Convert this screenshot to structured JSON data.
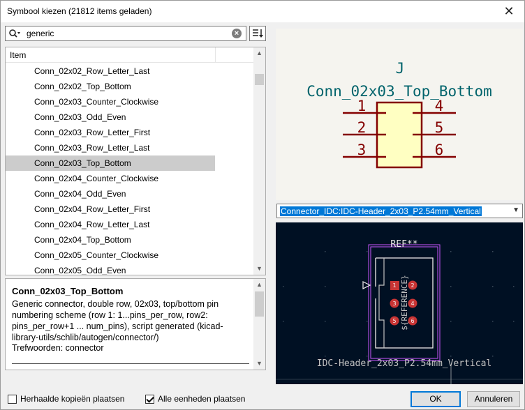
{
  "window": {
    "title": "Symbool kiezen (21812 items geladen)"
  },
  "search": {
    "value": "generic"
  },
  "tree": {
    "column_header": "Item",
    "items": [
      "Conn_02x02_Row_Letter_Last",
      "Conn_02x02_Top_Bottom",
      "Conn_02x03_Counter_Clockwise",
      "Conn_02x03_Odd_Even",
      "Conn_02x03_Row_Letter_First",
      "Conn_02x03_Row_Letter_Last",
      "Conn_02x03_Top_Bottom",
      "Conn_02x04_Counter_Clockwise",
      "Conn_02x04_Odd_Even",
      "Conn_02x04_Row_Letter_First",
      "Conn_02x04_Row_Letter_Last",
      "Conn_02x04_Top_Bottom",
      "Conn_02x05_Counter_Clockwise",
      "Conn_02x05_Odd_Even"
    ],
    "selected": "Conn_02x03_Top_Bottom"
  },
  "description": {
    "name": "Conn_02x03_Top_Bottom",
    "text": "Generic connector, double row, 02x03, top/bottom pin numbering scheme (row 1: 1...pins_per_row, row2: pins_per_row+1 ... num_pins), script generated (kicad-library-utils/schlib/autogen/connector/)",
    "keywords": "Trefwoorden: connector"
  },
  "symbol_preview": {
    "reference": "J",
    "value": "Conn_02x03_Top_Bottom",
    "pins": [
      "1",
      "2",
      "3",
      "4",
      "5",
      "6"
    ]
  },
  "footprint": {
    "selected": "Connector_IDC:IDC-Header_2x03_P2.54mm_Vertical",
    "ref_label": "REF**",
    "ref_field": "${REFERENCE}",
    "fp_name": "IDC-Header_2x03_P2.54mm_Vertical",
    "pad_numbers": [
      "1",
      "2",
      "3",
      "4",
      "5",
      "6"
    ]
  },
  "options": {
    "repeat_label": "Herhaalde kopieën plaatsen",
    "repeat_checked": false,
    "all_units_label": "Alle eenheden plaatsen",
    "all_units_checked": true
  },
  "buttons": {
    "ok": "OK",
    "cancel": "Annuleren"
  },
  "colors": {
    "pin": "#840000",
    "body_fill": "#ffffc2",
    "symbol_text": "#00636b",
    "pcb_bg": "#001023",
    "pad": "#c83434",
    "silk": "#f2eded",
    "courtyard": "#c2c2c2",
    "fab": "#ca56ff",
    "selection": "#0078d7"
  }
}
